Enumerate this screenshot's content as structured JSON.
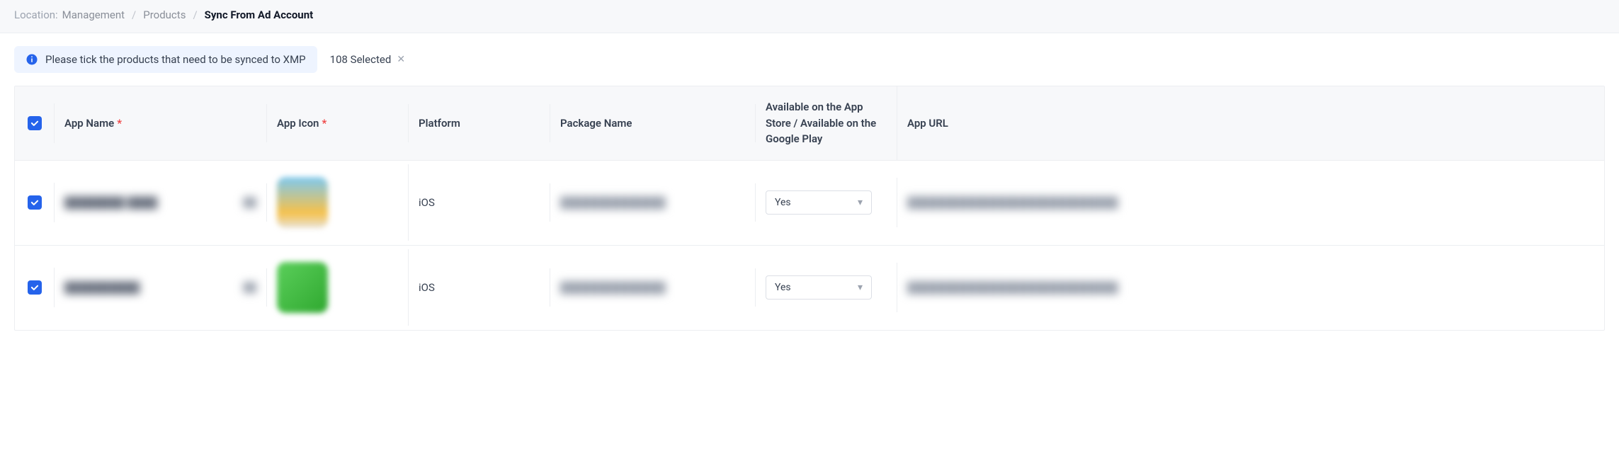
{
  "breadcrumb": {
    "location_label": "Location:",
    "items": [
      "Management",
      "Products",
      "Sync From Ad Account"
    ],
    "separator": "/"
  },
  "info_banner": {
    "text": "Please tick the products that need to be synced to XMP"
  },
  "selected": {
    "label": "108 Selected"
  },
  "columns": {
    "app_name": "App Name",
    "app_icon": "App Icon",
    "platform": "Platform",
    "package_name": "Package Name",
    "available": "Available on the App Store / Available on the Google Play",
    "app_url": "App URL"
  },
  "select_options": {
    "yes": "Yes"
  },
  "rows": [
    {
      "checked": true,
      "app_name": "████████ ████",
      "app_name_suffix": "· ██",
      "icon_class": "a",
      "platform": "iOS",
      "package_name": "██████████████",
      "available": "Yes",
      "app_url": "████████████████████████████"
    },
    {
      "checked": true,
      "app_name": "██████████",
      "app_name_suffix": "██",
      "icon_class": "b",
      "platform": "iOS",
      "package_name": "██████████████",
      "available": "Yes",
      "app_url": "████████████████████████████"
    }
  ]
}
